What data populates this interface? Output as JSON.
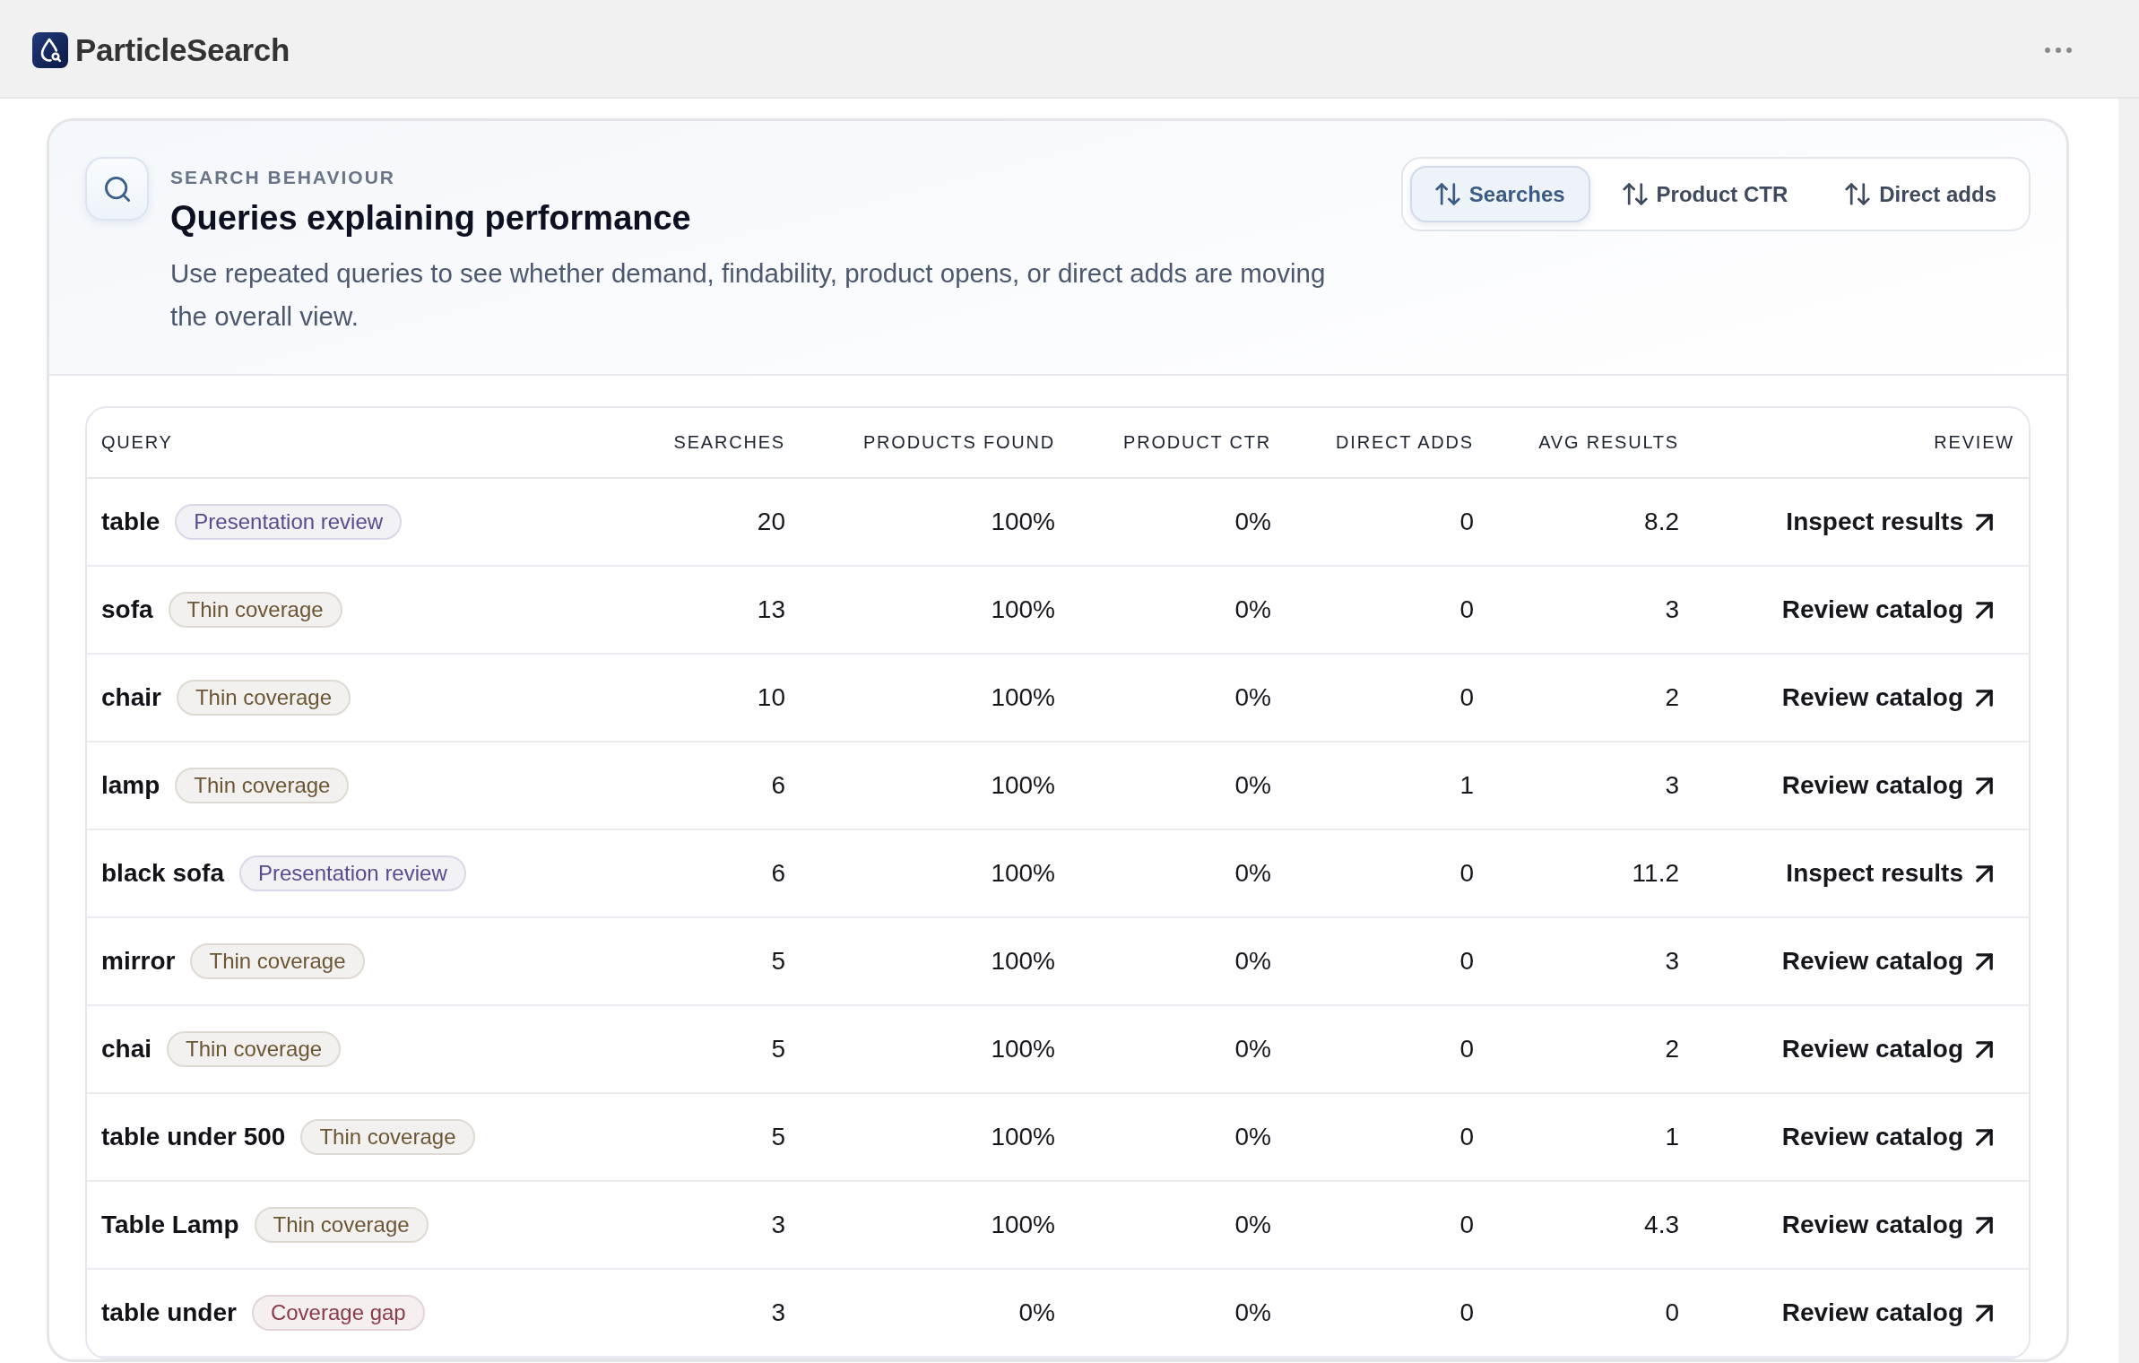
{
  "app_bar": {
    "brand": "ParticleSearch"
  },
  "panel": {
    "eyebrow": "SEARCH BEHAVIOUR",
    "title": "Queries explaining performance",
    "description": "Use repeated queries to see whether demand, findability, product opens, or direct adds are moving the overall view.",
    "sort_options": [
      {
        "label": "Searches",
        "selected": true
      },
      {
        "label": "Product CTR",
        "selected": false
      },
      {
        "label": "Direct adds",
        "selected": false
      }
    ]
  },
  "table": {
    "columns": [
      "QUERY",
      "SEARCHES",
      "PRODUCTS FOUND",
      "PRODUCT CTR",
      "DIRECT ADDS",
      "AVG RESULTS",
      "REVIEW"
    ],
    "rows": [
      {
        "query": "table",
        "tag": {
          "label": "Presentation review",
          "color": "#5b4a8f"
        },
        "searches": "20",
        "products_found": "100%",
        "product_ctr": "0%",
        "direct_adds": "0",
        "avg_results": "8.2",
        "review": "Inspect results"
      },
      {
        "query": "sofa",
        "tag": {
          "label": "Thin coverage",
          "color": "#6b5634"
        },
        "searches": "13",
        "products_found": "100%",
        "product_ctr": "0%",
        "direct_adds": "0",
        "avg_results": "3",
        "review": "Review catalog"
      },
      {
        "query": "chair",
        "tag": {
          "label": "Thin coverage",
          "color": "#6b5634"
        },
        "searches": "10",
        "products_found": "100%",
        "product_ctr": "0%",
        "direct_adds": "0",
        "avg_results": "2",
        "review": "Review catalog"
      },
      {
        "query": "lamp",
        "tag": {
          "label": "Thin coverage",
          "color": "#6b5634"
        },
        "searches": "6",
        "products_found": "100%",
        "product_ctr": "0%",
        "direct_adds": "1",
        "avg_results": "3",
        "review": "Review catalog"
      },
      {
        "query": "black sofa",
        "tag": {
          "label": "Presentation review",
          "color": "#5b4a8f"
        },
        "searches": "6",
        "products_found": "100%",
        "product_ctr": "0%",
        "direct_adds": "0",
        "avg_results": "11.2",
        "review": "Inspect results"
      },
      {
        "query": "mirror",
        "tag": {
          "label": "Thin coverage",
          "color": "#6b5634"
        },
        "searches": "5",
        "products_found": "100%",
        "product_ctr": "0%",
        "direct_adds": "0",
        "avg_results": "3",
        "review": "Review catalog"
      },
      {
        "query": "chai",
        "tag": {
          "label": "Thin coverage",
          "color": "#6b5634"
        },
        "searches": "5",
        "products_found": "100%",
        "product_ctr": "0%",
        "direct_adds": "0",
        "avg_results": "2",
        "review": "Review catalog"
      },
      {
        "query": "table under 500",
        "tag": {
          "label": "Thin coverage",
          "color": "#6b5634"
        },
        "searches": "5",
        "products_found": "100%",
        "product_ctr": "0%",
        "direct_adds": "0",
        "avg_results": "1",
        "review": "Review catalog"
      },
      {
        "query": "Table Lamp",
        "tag": {
          "label": "Thin coverage",
          "color": "#6b5634"
        },
        "searches": "3",
        "products_found": "100%",
        "product_ctr": "0%",
        "direct_adds": "0",
        "avg_results": "4.3",
        "review": "Review catalog"
      },
      {
        "query": "table under",
        "tag": {
          "label": "Coverage gap",
          "color": "#8a3a48"
        },
        "searches": "3",
        "products_found": "0%",
        "product_ctr": "0%",
        "direct_adds": "0",
        "avg_results": "0",
        "review": "Review catalog"
      }
    ]
  }
}
